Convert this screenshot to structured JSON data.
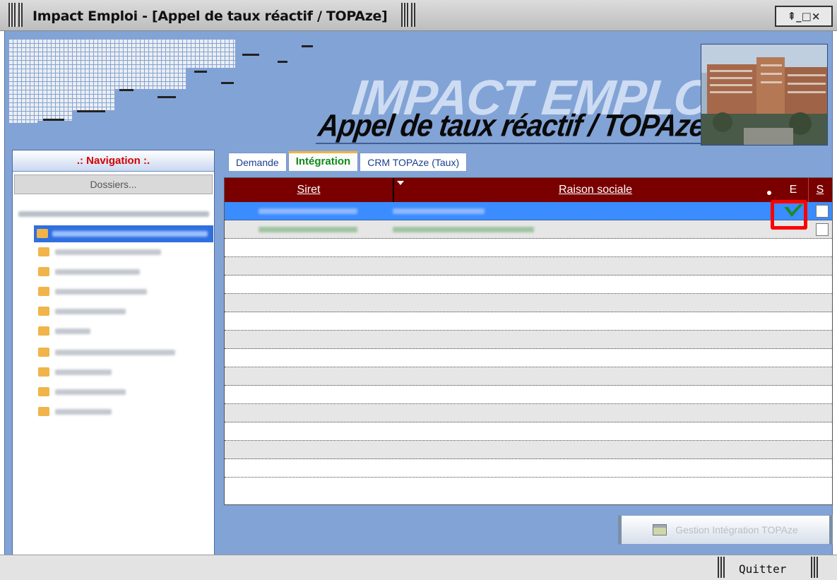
{
  "window": {
    "title": "Impact Emploi - [Appel de taux réactif / TOPAze]",
    "controls": "⇞_□×"
  },
  "header": {
    "brand": "IMPACT EMPLOI",
    "title": "Appel de taux réactif / TOPAze"
  },
  "navigation": {
    "title": ".: Navigation :.",
    "dossiers_label": "Dossiers..."
  },
  "tabs": [
    {
      "label": "Demande",
      "active": false
    },
    {
      "label": "Intégration",
      "active": true
    },
    {
      "label": "CRM TOPAze (Taux)",
      "active": false
    }
  ],
  "grid": {
    "columns": [
      "Siret",
      "Raison sociale",
      "E",
      "S"
    ]
  },
  "buttons": {
    "gestion_label": "Gestion Intégration TOPAze",
    "quitter_label": "Quitter"
  },
  "colors": {
    "header_bg": "#82a3d6",
    "grid_header": "#7a0000",
    "selected_row": "#3b8cff",
    "highlight": "#ff0000",
    "nav_title": "#d40000"
  }
}
